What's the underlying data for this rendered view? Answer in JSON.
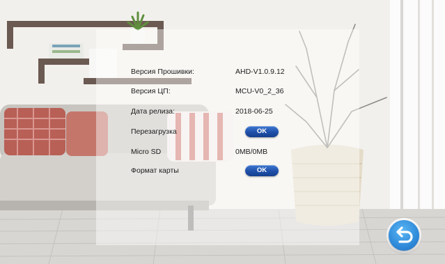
{
  "settings": {
    "rows": [
      {
        "label": "Версия Прошивки:",
        "value": "AHD-V1.0.9.12"
      },
      {
        "label": "Версия ЦП:",
        "value": "MCU-V0_2_36"
      },
      {
        "label": "Дата релиза:",
        "value": "2018-06-25"
      },
      {
        "label": "Перезагрузка",
        "button": "OK"
      },
      {
        "label": "Micro SD",
        "value": "0MB/0MB"
      },
      {
        "label": "Формат карты",
        "button": "OK"
      }
    ]
  },
  "colors": {
    "button": "#1f4fa8",
    "back_button": "#2f8ad9",
    "panel_text": "#1b1b1b"
  },
  "icons": {
    "back": "return-arrow-icon"
  }
}
